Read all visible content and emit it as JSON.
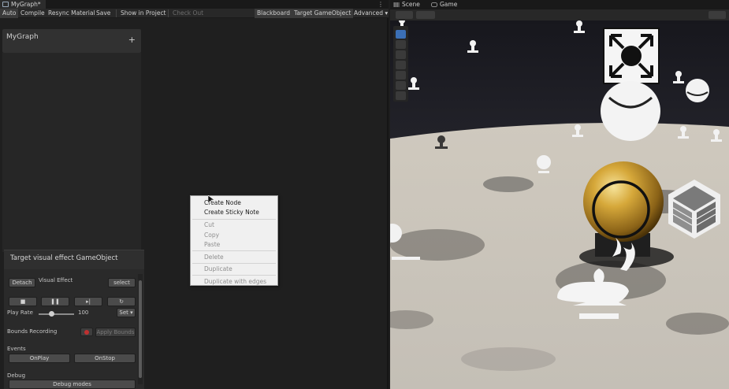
{
  "left_window": {
    "tab_title": "MyGraph*",
    "toolbar": {
      "auto": "Auto",
      "compile": "Compile",
      "resync": "Resync Material",
      "save": "Save",
      "show_in_project": "Show in Project",
      "check_out": "Check Out",
      "blackboard": "Blackboard",
      "target_gameobject": "Target GameObject",
      "advanced": "Advanced ▾"
    },
    "blackboard": {
      "title": "MyGraph",
      "add": "+"
    },
    "context_menu": {
      "items": [
        "Create Node",
        "Create Sticky Note",
        "Cut",
        "Copy",
        "Paste",
        "Delete",
        "Duplicate",
        "Duplicate with edges"
      ]
    },
    "target_panel": {
      "title": "Target visual effect GameObject",
      "detach": "Detach",
      "visual_effect_label": "Visual Effect",
      "select": "select",
      "play_controls": [
        "■",
        "❚❚",
        "▸|",
        "↻"
      ],
      "play_rate_label": "Play Rate",
      "play_rate_value": "100",
      "set": "Set ▾",
      "bounds_recording_label": "Bounds Recording",
      "apply_bounds": "Apply Bounds",
      "events_label": "Events",
      "on_play": "OnPlay",
      "on_stop": "OnStop",
      "debug_label": "Debug",
      "debug_modes": "Debug modes"
    }
  },
  "right_window": {
    "tabs": [
      "Scene",
      "Game"
    ]
  },
  "colors": {
    "accent_blue": "#3b6fb6",
    "gold_sphere": "#c79a2c"
  }
}
